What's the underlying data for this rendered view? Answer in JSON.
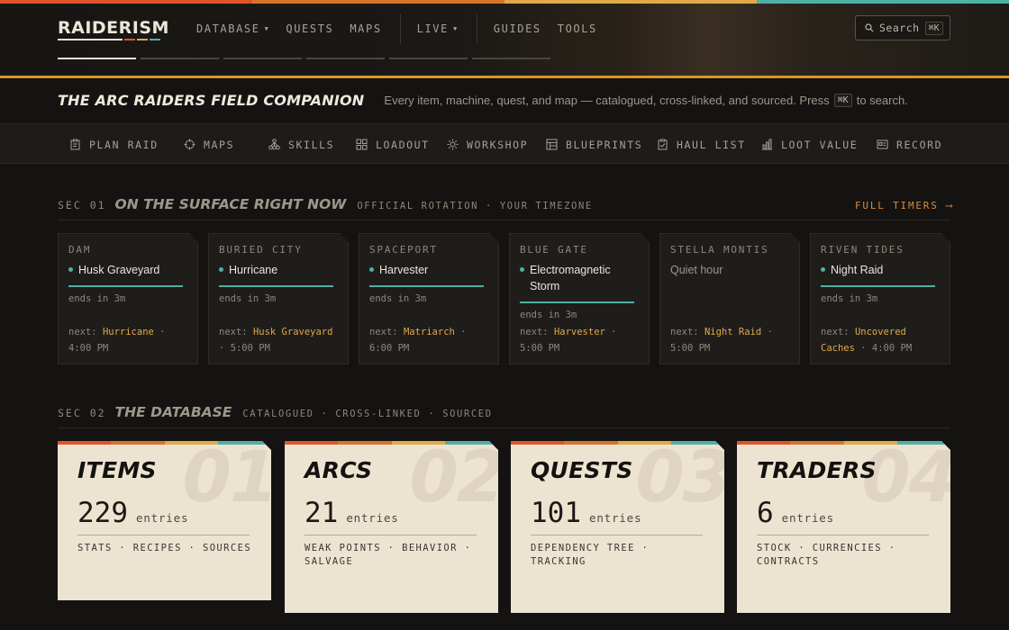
{
  "colors": {
    "stripe": [
      "#e0542a",
      "#d7742c",
      "#e0a94a",
      "#4fb0a6"
    ],
    "accent_orange": "#d88a3e",
    "status_teal": "#4fb0a6",
    "highlight_yellow": "#e0a94a",
    "card_paper": "#ece3d1"
  },
  "nav": {
    "logo": "RAIDERISM",
    "items": [
      {
        "label": "DATABASE",
        "has_dropdown": true
      },
      {
        "label": "QUESTS",
        "has_dropdown": false
      },
      {
        "label": "MAPS",
        "has_dropdown": false
      },
      {
        "label": "LIVE",
        "has_dropdown": true
      },
      {
        "label": "GUIDES",
        "has_dropdown": false
      },
      {
        "label": "TOOLS",
        "has_dropdown": false
      }
    ],
    "caret": "▼",
    "search_label": "Search",
    "search_shortcut": "⌘K"
  },
  "hero": {
    "slides": 6,
    "active_slide": 1
  },
  "tagline": {
    "title": "THE ARC RAIDERS FIELD COMPANION",
    "desc_before": "Every item, machine, quest, and map — catalogued, cross-linked, and sourced. Press",
    "shortcut": "⌘K",
    "desc_after": "to search."
  },
  "tools": [
    {
      "label": "PLAN RAID",
      "icon": "clipboard-icon"
    },
    {
      "label": "MAPS",
      "icon": "crosshair-icon"
    },
    {
      "label": "SKILLS",
      "icon": "skill-tree-icon"
    },
    {
      "label": "LOADOUT",
      "icon": "grid-icon"
    },
    {
      "label": "WORKSHOP",
      "icon": "gear-sun-icon"
    },
    {
      "label": "BLUEPRINTS",
      "icon": "blueprint-icon"
    },
    {
      "label": "HAUL LIST",
      "icon": "checklist-icon"
    },
    {
      "label": "LOOT VALUE",
      "icon": "bar-chart-icon"
    },
    {
      "label": "RECORD",
      "icon": "record-icon"
    }
  ],
  "sections": {
    "surface": {
      "num": "SEC 01",
      "title": "ON THE SURFACE RIGHT NOW",
      "subtitle": "OFFICIAL ROTATION · YOUR TIMEZONE",
      "link": "FULL TIMERS ⟶"
    },
    "database": {
      "num": "SEC 02",
      "title": "THE DATABASE",
      "subtitle": "CATALOGUED · CROSS-LINKED · SOURCED"
    }
  },
  "maps": [
    {
      "name": "DAM",
      "condition": "Husk Graveyard",
      "active": true,
      "ends": "ends in 3m",
      "next_label": "next:",
      "next_event": "Hurricane",
      "next_time": "· 4:00 PM"
    },
    {
      "name": "BURIED CITY",
      "condition": "Hurricane",
      "active": true,
      "ends": "ends in 3m",
      "next_label": "next:",
      "next_event": "Husk Graveyard",
      "next_time": "· 5:00 PM"
    },
    {
      "name": "SPACEPORT",
      "condition": "Harvester",
      "active": true,
      "ends": "ends in 3m",
      "next_label": "next:",
      "next_event": "Matriarch",
      "next_time": "· 6:00 PM"
    },
    {
      "name": "BLUE GATE",
      "condition": "Electromagnetic Storm",
      "active": true,
      "ends": "ends in 3m",
      "next_label": "next:",
      "next_event": "Harvester",
      "next_time": "· 5:00 PM"
    },
    {
      "name": "STELLA MONTIS",
      "condition": "Quiet hour",
      "active": false,
      "ends": "",
      "next_label": "next:",
      "next_event": "Night Raid",
      "next_time": "· 5:00 PM"
    },
    {
      "name": "RIVEN TIDES",
      "condition": "Night Raid",
      "active": true,
      "ends": "ends in 3m",
      "next_label": "next:",
      "next_event": "Uncovered Caches",
      "next_time": "· 4:00 PM"
    }
  ],
  "database": [
    {
      "title": "ITEMS",
      "watermark": "01",
      "count": "229",
      "unit": "entries",
      "tags": "STATS · RECIPES · SOURCES"
    },
    {
      "title": "ARCS",
      "watermark": "02",
      "count": "21",
      "unit": "entries",
      "tags": "WEAK POINTS · BEHAVIOR · SALVAGE"
    },
    {
      "title": "QUESTS",
      "watermark": "03",
      "count": "101",
      "unit": "entries",
      "tags": "DEPENDENCY TREE · TRACKING"
    },
    {
      "title": "TRADERS",
      "watermark": "04",
      "count": "6",
      "unit": "entries",
      "tags": "STOCK · CURRENCIES · CONTRACTS"
    }
  ]
}
